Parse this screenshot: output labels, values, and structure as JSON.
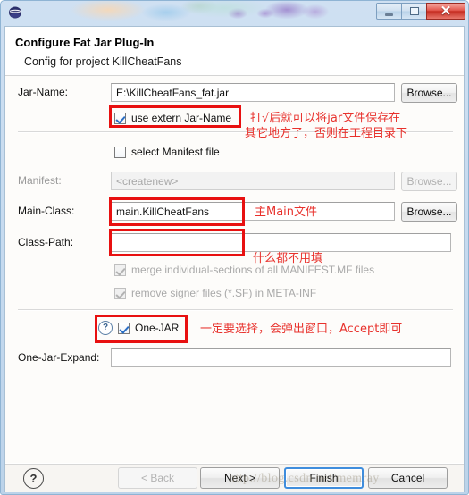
{
  "window": {
    "app_icon": "eclipse-icon",
    "controls": {
      "minimize": "—",
      "maximize": "▢",
      "close": "✕"
    }
  },
  "header": {
    "title": "Configure Fat Jar Plug-In",
    "subtitle": "Config for project KillCheatFans"
  },
  "form": {
    "jar_name": {
      "label": "Jar-Name:",
      "value": "E:\\KillCheatFans_fat.jar",
      "placeholder": "",
      "browse_label": "Browse..."
    },
    "use_extern": {
      "label": "use extern Jar-Name",
      "checked": true
    },
    "select_manifest": {
      "label": "select Manifest file",
      "checked": false
    },
    "manifest": {
      "label": "Manifest:",
      "value": "<createnew>",
      "browse_label": "Browse...",
      "disabled": true
    },
    "main_class": {
      "label": "Main-Class:",
      "value": "main.KillCheatFans",
      "browse_label": "Browse..."
    },
    "class_path": {
      "label": "Class-Path:",
      "value": ""
    },
    "merge_sections": {
      "label": "merge individual-sections of all MANIFEST.MF files",
      "checked": true,
      "disabled": true
    },
    "remove_signer": {
      "label": "remove signer files (*.SF) in META-INF",
      "checked": true,
      "disabled": true
    },
    "one_jar": {
      "help_icon": "?",
      "label": "One-JAR",
      "checked": true
    },
    "one_jar_expand": {
      "label": "One-Jar-Expand:",
      "value": ""
    }
  },
  "annotations": {
    "jar_name_line1": "打√后就可以将jar文件保存在",
    "jar_name_line2": "其它地方了，否则在工程目录下",
    "main_class": "主Main文件",
    "class_path": "什么都不用填",
    "one_jar": "一定要选择，会弹出窗口，Accept即可"
  },
  "footer": {
    "help_icon": "?",
    "back_label": "< Back",
    "next_label": "Next >",
    "finish_label": "Finish",
    "cancel_label": "Cancel"
  },
  "watermark": "http://blog.csdn.net/memray",
  "colors": {
    "annotation_red": "#e8312c",
    "highlight_box": "#e81010",
    "default_button_border": "#3f8ddd",
    "close_button": "#c52d22"
  }
}
